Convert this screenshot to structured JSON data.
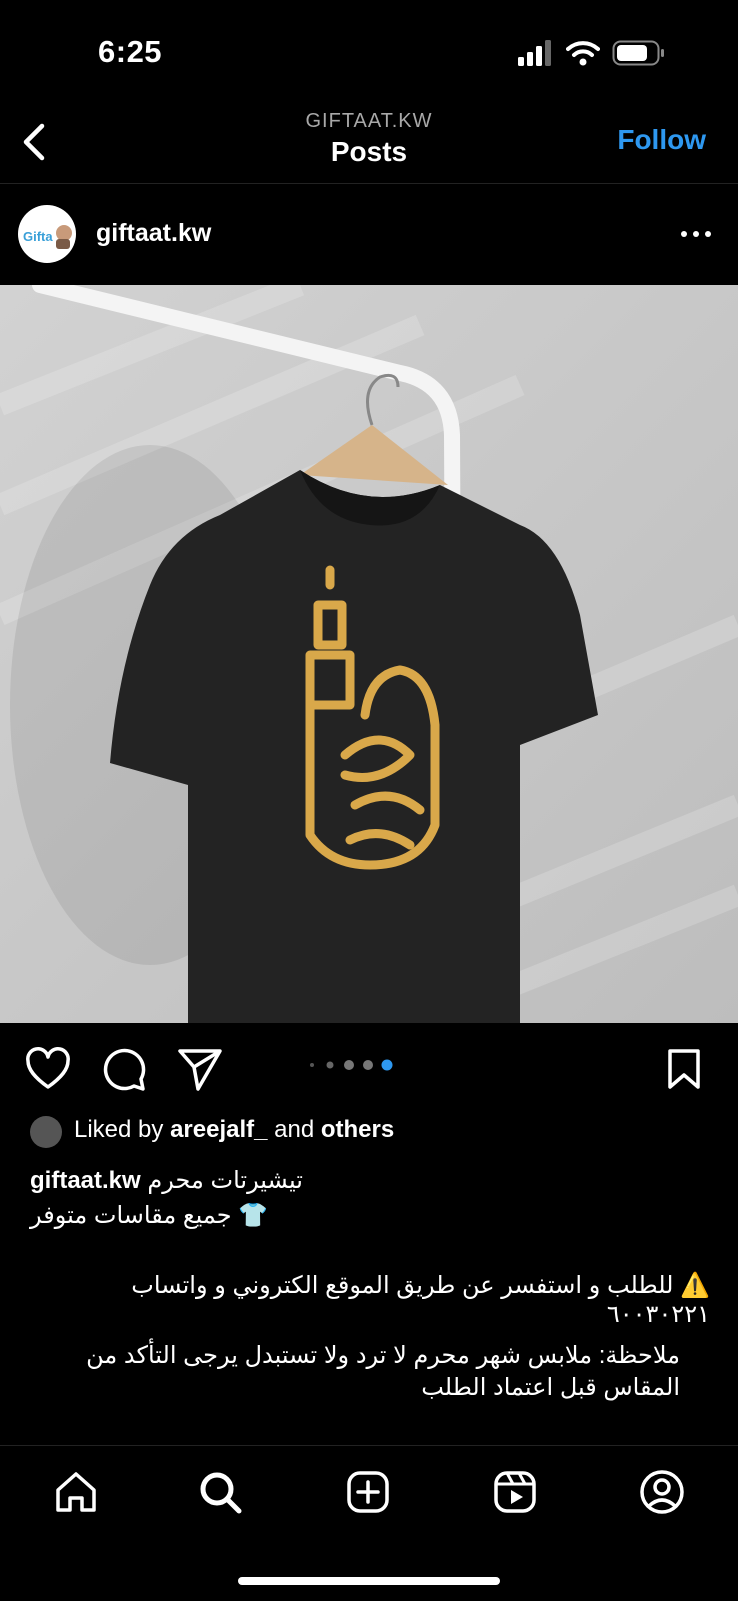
{
  "status_bar": {
    "time": "6:25"
  },
  "header": {
    "account_caps": "GIFTAAT.KW",
    "title": "Posts",
    "follow_label": "Follow"
  },
  "post": {
    "username": "giftaat.kw",
    "avatar_text": "Gifta",
    "carousel": {
      "count": 5,
      "active_index": 4
    },
    "liked_by": {
      "prefix": "Liked by ",
      "user": "areejalf_",
      "middle": " and ",
      "others": "others"
    },
    "caption": {
      "author": "giftaat.kw",
      "line1": "تيشيرتات محرم",
      "line2": "👕 جميع مقاسات متوفر",
      "line3": "⚠️ للطلب و استفسر عن طريق الموقع الكتروني و واتساب ٦٠٠٣٠٢٢١",
      "line4": "ملاحظة: ملابس شهر محرم لا ترد ولا تستبدل يرجى التأكد من المقاس قبل اعتماد الطلب"
    }
  },
  "icons": {
    "back": "chevron-left-icon",
    "more": "ellipsis-icon",
    "like": "heart-icon",
    "comment": "comment-icon",
    "share": "paper-plane-icon",
    "save": "bookmark-icon",
    "home": "home-icon",
    "search": "search-icon",
    "create": "plus-square-icon",
    "reels": "reels-icon",
    "profile": "profile-icon"
  },
  "colors": {
    "accent": "#2e98f0",
    "shirt": "#232323",
    "print": "#d9a84a",
    "wall": "#c9c9c9"
  }
}
